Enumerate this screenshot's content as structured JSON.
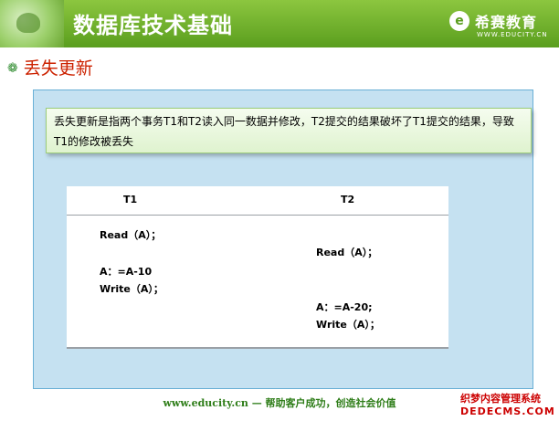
{
  "header": {
    "title": "数据库技术基础",
    "logo_mark": "e",
    "logo_text": "希赛教育",
    "logo_sub": "WWW.EDUCITY.CN"
  },
  "section": {
    "bullet": "❁",
    "title": "丢失更新"
  },
  "description": "丢失更新是指两个事务T1和T2读入同一数据并修改，T2提交的结果破坏了T1提交的结果，导致T1的修改被丢失",
  "table": {
    "headers": [
      "T1",
      "T2"
    ],
    "operations": [
      {
        "col": "T1",
        "text": "Read（A）；"
      },
      {
        "col": "T2",
        "text": "Read（A）；"
      },
      {
        "col": "T1",
        "text": "A：=A-10"
      },
      {
        "col": "T1",
        "text": "Write（A）；"
      },
      {
        "col": "T2",
        "text": "A：=A-20;"
      },
      {
        "col": "T2",
        "text": "Write（A）；"
      }
    ]
  },
  "footer": "www.educity.cn  —  帮助客户成功，创造社会价值",
  "watermark": {
    "line1": "织梦内容管理系统",
    "line2": "DEDECMS.COM"
  },
  "colors": {
    "header_green": "#5a9e1e",
    "section_title": "#cc2200",
    "panel_blue": "#c5e1f1",
    "footer_green": "#2e7d18"
  }
}
